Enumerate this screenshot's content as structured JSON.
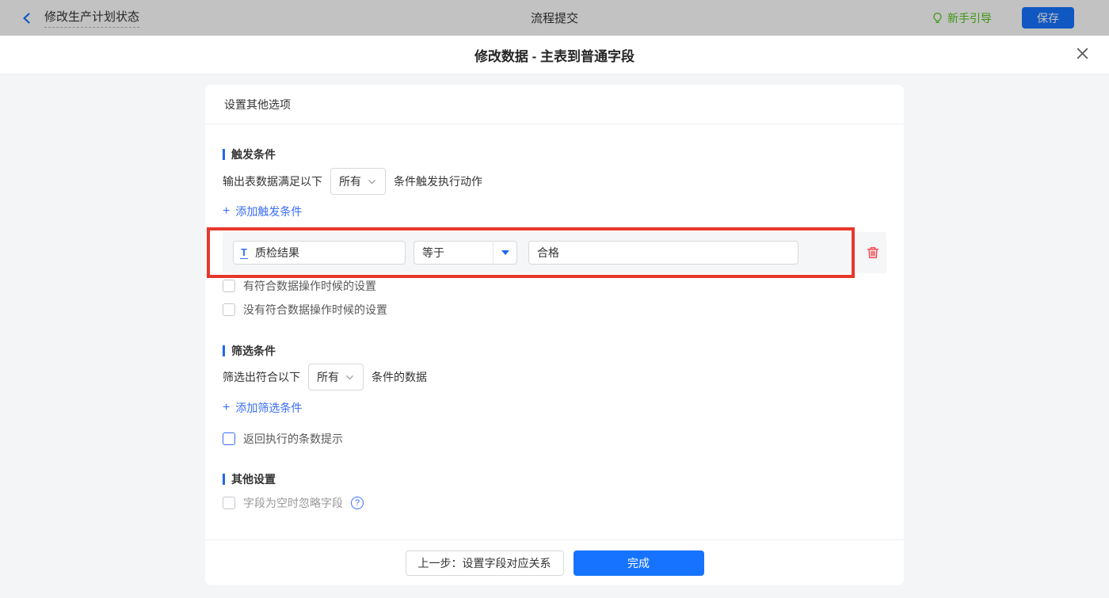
{
  "icons": {
    "plus": "+",
    "field_type": "T",
    "help": "?"
  },
  "topbar": {
    "back_title": "修改生产计划状态",
    "center_title": "流程提交",
    "guide_label": "新手引导",
    "save_label": "保存"
  },
  "modal": {
    "title": "修改数据 - 主表到普通字段"
  },
  "panel": {
    "header": "设置其他选项",
    "trigger": {
      "title": "触发条件",
      "prefix": "输出表数据满足以下",
      "select_value": "所有",
      "suffix": "条件触发执行动作",
      "add": "添加触发条件",
      "condition": {
        "field": "质检结果",
        "operator": "等于",
        "value": "合格"
      },
      "checkboxes": [
        "有符合数据操作时候的设置",
        "没有符合数据操作时候的设置"
      ]
    },
    "filter": {
      "title": "筛选条件",
      "prefix": "筛选出符合以下",
      "select_value": "所有",
      "suffix": "条件的数据",
      "add": "添加筛选条件",
      "checkbox": "返回执行的条数提示"
    },
    "other": {
      "title": "其他设置",
      "checkbox": "字段为空时忽略字段"
    },
    "footer": {
      "back": "上一步：设置字段对应关系",
      "done": "完成"
    }
  },
  "colors": {
    "primary": "#1673ff",
    "link": "#3a6ef5",
    "section_bar": "#2166f2",
    "annotation_red": "#e8372c",
    "danger": "#f5434a",
    "guide_green": "#52c41a"
  }
}
